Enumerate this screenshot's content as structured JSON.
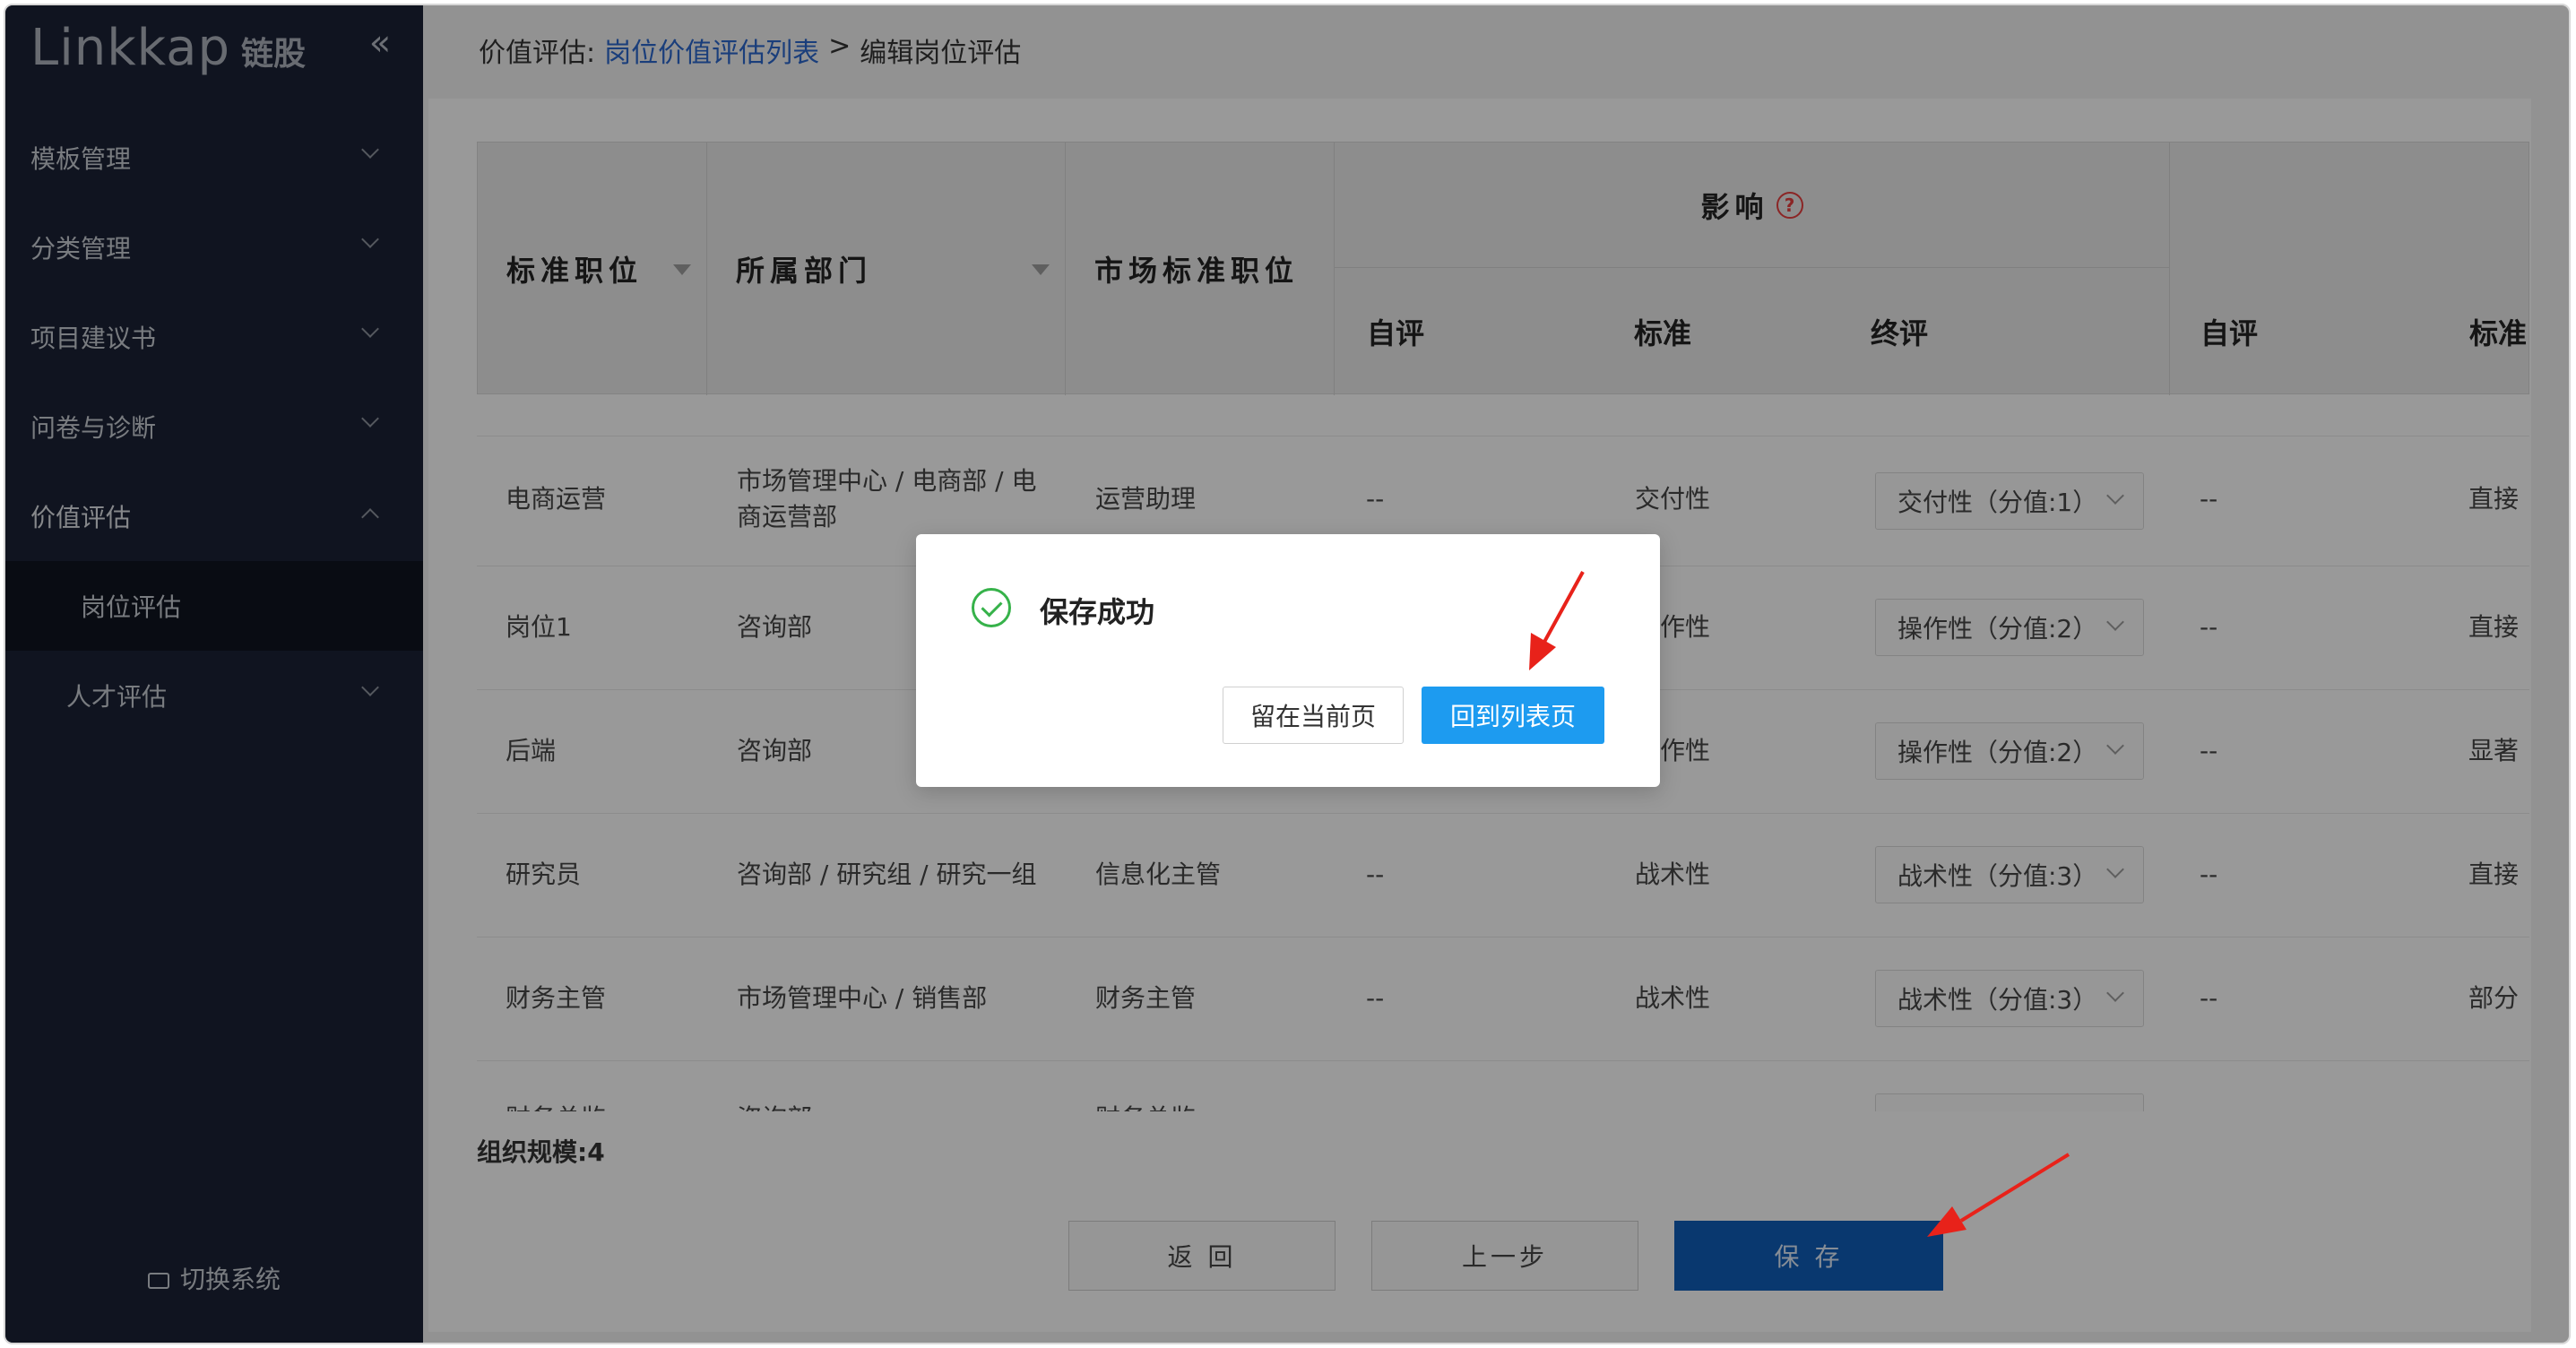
{
  "brand": {
    "name_en": "Linkkap",
    "name_cn": "链股"
  },
  "sidebar": {
    "collapse_glyph": "«",
    "items": [
      {
        "label": "模板管理"
      },
      {
        "label": "分类管理"
      },
      {
        "label": "项目建议书"
      },
      {
        "label": "问卷与诊断"
      },
      {
        "label": "价值评估",
        "sub": "岗位评估"
      },
      {
        "label": "人才评估"
      }
    ],
    "switch_label": "切换系统"
  },
  "breadcrumb": {
    "prefix": "价值评估:",
    "link": "岗位价值评估列表",
    "sep": ">",
    "current": "编辑岗位评估"
  },
  "table": {
    "headers": {
      "std_position": "标准职位",
      "department": "所属部门",
      "market_position": "市场标准职位",
      "influence": "影响",
      "self_eval": "自评",
      "standard": "标准",
      "final_eval": "终评",
      "self_eval_2": "自评",
      "standard_2": "标准"
    },
    "rows": [
      {
        "position": "电商运营",
        "dept": "市场管理中心 / 电商部 / 电商运营部",
        "market": "运营助理",
        "self": "--",
        "std": "交付性",
        "final": "交付性（分值:1）",
        "self2": "--",
        "std2": "直接"
      },
      {
        "position": "岗位1",
        "dept": "咨询部",
        "market": "",
        "self": "",
        "std": "操作性",
        "final": "操作性（分值:2）",
        "self2": "--",
        "std2": "直接"
      },
      {
        "position": "后端",
        "dept": "咨询部",
        "market": "",
        "self": "",
        "std": "操作性",
        "final": "操作性（分值:2）",
        "self2": "--",
        "std2": "显著"
      },
      {
        "position": "研究员",
        "dept": "咨询部 / 研究组 / 研究一组",
        "market": "信息化主管",
        "self": "--",
        "std": "战术性",
        "final": "战术性（分值:3）",
        "self2": "--",
        "std2": "直接"
      },
      {
        "position": "财务主管",
        "dept": "市场管理中心 / 销售部",
        "market": "财务主管",
        "self": "--",
        "std": "战术性",
        "final": "战术性（分值:3）",
        "self2": "--",
        "std2": "部分"
      },
      {
        "position": "财务总监",
        "dept": "咨询部",
        "market": "财务总监",
        "self": "",
        "std": "",
        "final": "",
        "self2": "",
        "std2": ""
      }
    ]
  },
  "org_size": "组织规模:4",
  "buttons": {
    "back": "返 回",
    "prev": "上一步",
    "save": "保 存"
  },
  "dialog": {
    "message": "保存成功",
    "stay": "留在当前页",
    "to_list": "回到列表页"
  },
  "colors": {
    "primary": "#1d9bf0",
    "success": "#36b24a",
    "sidebar_bg": "#1b2134",
    "annotation": "#e8221a"
  }
}
